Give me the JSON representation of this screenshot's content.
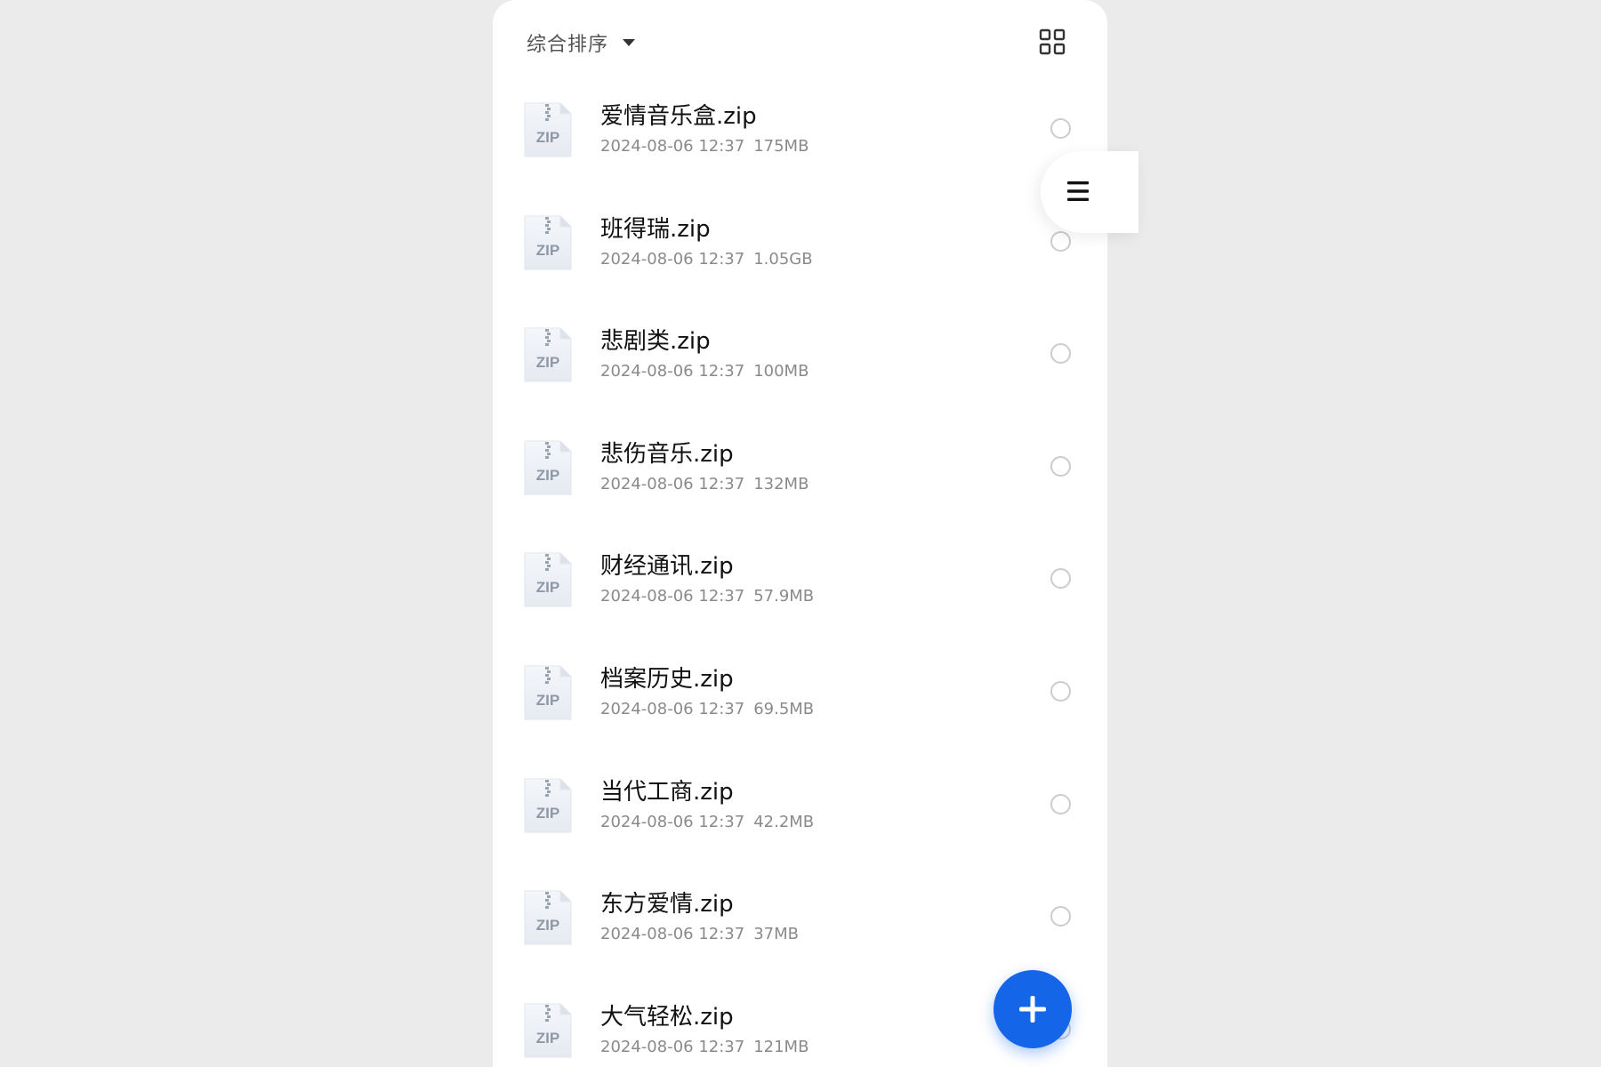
{
  "toolbar": {
    "sort_label": "综合排序",
    "sort_icon": "caret-down-icon",
    "view_toggle_icon": "grid-view-icon"
  },
  "files": [
    {
      "name": "爱情音乐盒.zip",
      "time": "2024-08-06 12:37",
      "size": "175MB",
      "icon_label": "ZIP"
    },
    {
      "name": "班得瑞.zip",
      "time": "2024-08-06 12:37",
      "size": "1.05GB",
      "icon_label": "ZIP"
    },
    {
      "name": "悲剧类.zip",
      "time": "2024-08-06 12:37",
      "size": "100MB",
      "icon_label": "ZIP"
    },
    {
      "name": "悲伤音乐.zip",
      "time": "2024-08-06 12:37",
      "size": "132MB",
      "icon_label": "ZIP"
    },
    {
      "name": "财经通讯.zip",
      "time": "2024-08-06 12:37",
      "size": "57.9MB",
      "icon_label": "ZIP"
    },
    {
      "name": "档案历史.zip",
      "time": "2024-08-06 12:37",
      "size": "69.5MB",
      "icon_label": "ZIP"
    },
    {
      "name": "当代工商.zip",
      "time": "2024-08-06 12:37",
      "size": "42.2MB",
      "icon_label": "ZIP"
    },
    {
      "name": "东方爱情.zip",
      "time": "2024-08-06 12:37",
      "size": "37MB",
      "icon_label": "ZIP"
    },
    {
      "name": "大气轻松.zip",
      "time": "2024-08-06 12:37",
      "size": "121MB",
      "icon_label": "ZIP"
    }
  ],
  "side_handle": {
    "icon": "menu-icon"
  },
  "fab": {
    "icon": "plus-icon",
    "color": "#1565e8"
  },
  "colors": {
    "background": "#ebebeb",
    "panel": "#ffffff",
    "accent": "#1565e8",
    "primary_text": "#111111",
    "secondary_text": "#8a8a8a"
  }
}
